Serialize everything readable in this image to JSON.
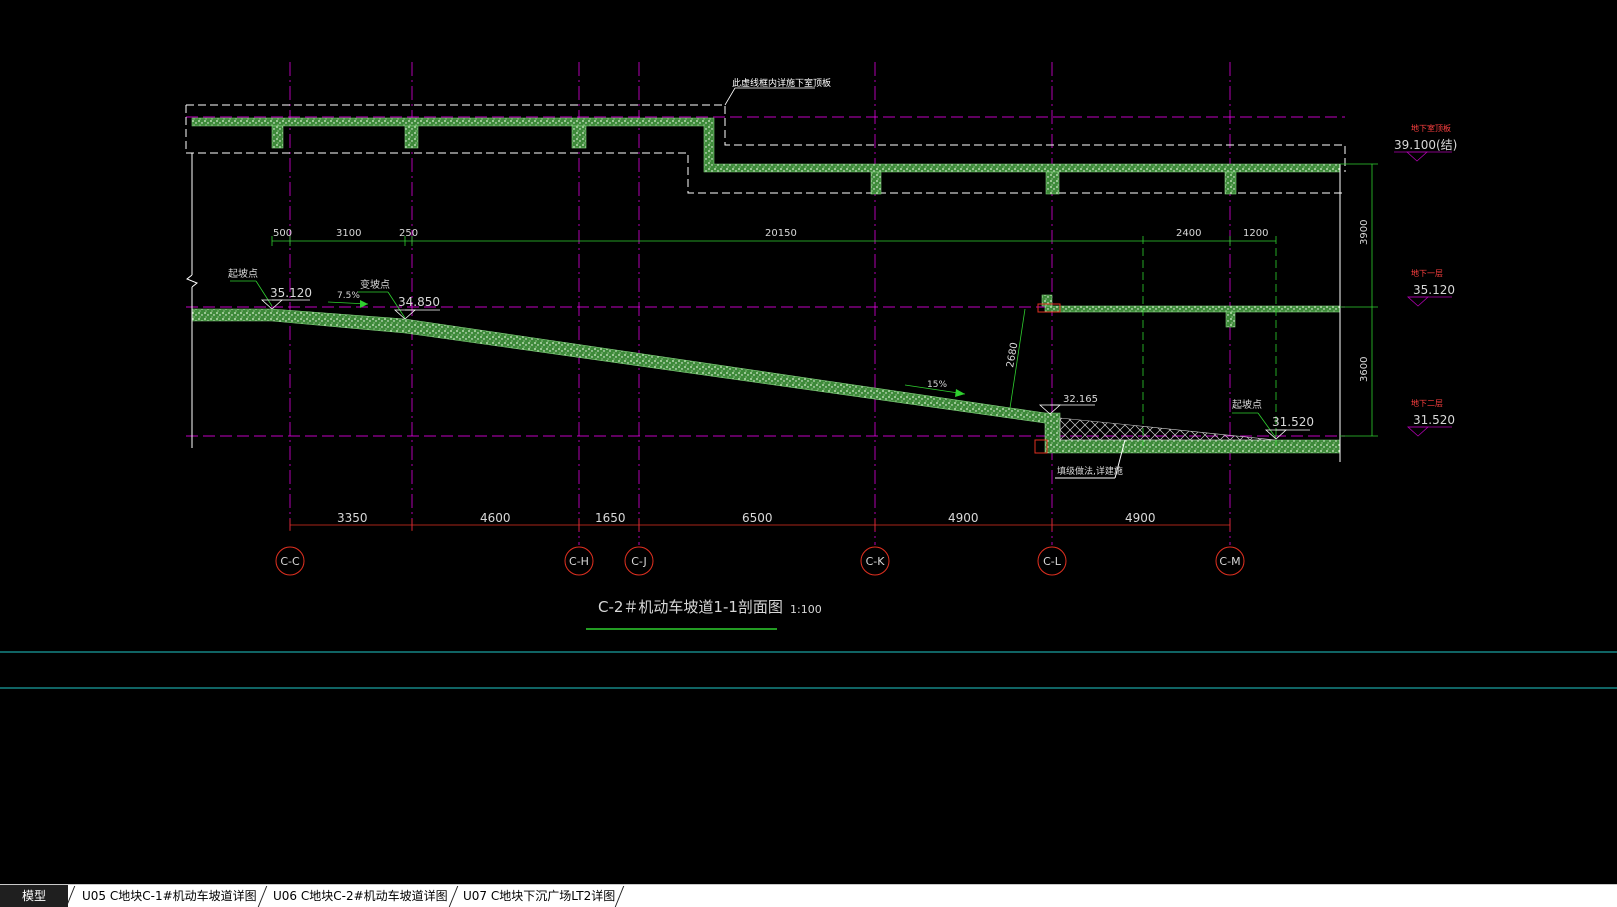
{
  "colors": {
    "background": "#000000",
    "slab_fill": "#3e8a3a",
    "dim_line": "#2fd02f",
    "grid_axis": "#b000b0",
    "axis_bubble": "#e03020",
    "ref_line": "#ff00ff",
    "cyan_line": "#1aa0a0",
    "label_red": "#ff4040"
  },
  "drawing": {
    "title": "C-2＃机动车坡道1-1剖面图",
    "scale": "1:100",
    "top_note": "此虚线框内详施下室顶板",
    "elevations": {
      "roof_label": "地下室顶板",
      "roof_value": "39.100(结)",
      "b1_label": "地下一层",
      "b1_value": "35.120",
      "b2_label": "地下二层",
      "b2_value": "31.520"
    },
    "ramp_labels": {
      "start_point_1": "起坡点",
      "start_elev": "35.120",
      "change_point": "变坡点",
      "change_elev": "34.850",
      "slope_1": "7.5%",
      "slope_2": "15%",
      "elev_mid": "32.165",
      "end_point": "起坡点",
      "end_elev": "31.520",
      "fill_note": "填级做法,详建施",
      "clear_height": "2680"
    },
    "top_dims": [
      "500",
      "3100",
      "250",
      "20150",
      "2400",
      "1200"
    ],
    "right_dims": [
      "3900",
      "3600"
    ],
    "bottom_dims": [
      "3350",
      "4600",
      "1650",
      "6500",
      "4900",
      "4900"
    ],
    "axes": [
      "C-C",
      "C-H",
      "C-J",
      "C-K",
      "C-L",
      "C-M"
    ]
  },
  "tabs": {
    "model": "模型",
    "layout1": "U05 C地块C-1#机动车坡道详图",
    "layout2": "U06 C地块C-2#机动车坡道详图",
    "layout3": "U07 C地块下沉广场LT2详图"
  }
}
